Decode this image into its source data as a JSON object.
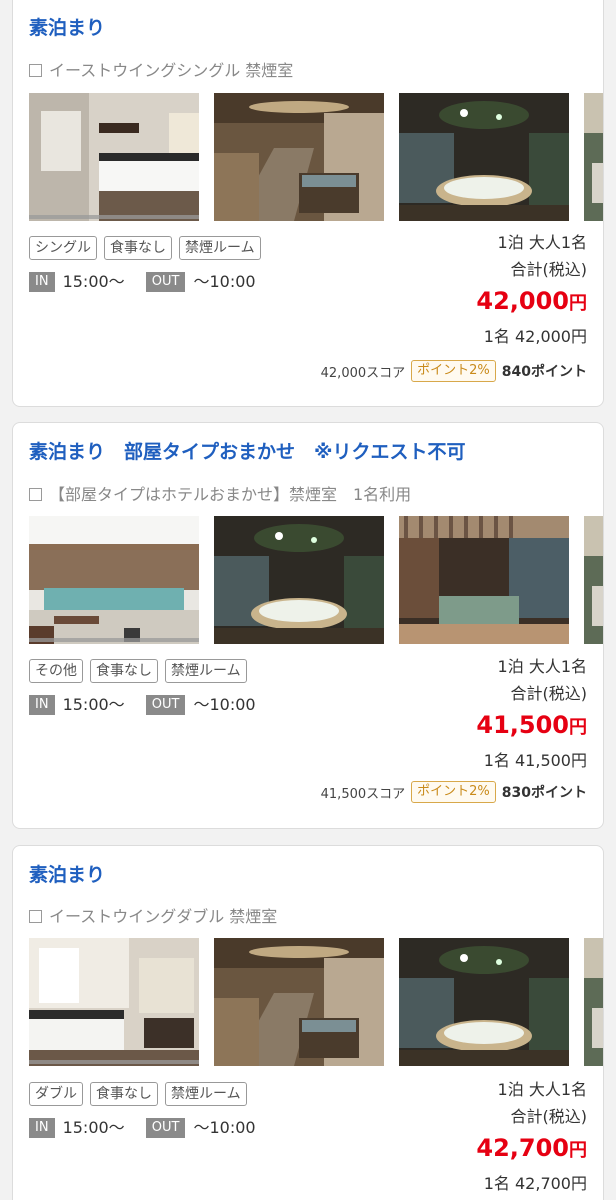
{
  "plans": [
    {
      "title": "素泊まり",
      "room": "イーストウイングシングル 禁煙室",
      "photos": [
        "single-room-photo",
        "indoor-bath-photo",
        "jacuzzi-photo",
        "garden-photo"
      ],
      "tags": [
        "シングル",
        "食事なし",
        "禁煙ルーム"
      ],
      "checkin_label": "IN",
      "checkin_time": "15:00〜",
      "checkout_label": "OUT",
      "checkout_time": "〜10:00",
      "guests": "1泊 大人1名",
      "tax_label": "合計(税込)",
      "total": "42,000",
      "currency": "円",
      "per_person": "1名 42,000円",
      "score": "42,000スコア",
      "point_rate": "ポイント2%",
      "points": "840ポイント"
    },
    {
      "title": "素泊まり　部屋タイプおまかせ　※リクエスト不可",
      "room": "【部屋タイプはホテルおまかせ】禁煙室　1名利用",
      "photos": [
        "open-air-bath-photo",
        "jacuzzi-photo",
        "terrace-bath-photo",
        "garden-photo"
      ],
      "tags": [
        "その他",
        "食事なし",
        "禁煙ルーム"
      ],
      "checkin_label": "IN",
      "checkin_time": "15:00〜",
      "checkout_label": "OUT",
      "checkout_time": "〜10:00",
      "guests": "1泊 大人1名",
      "tax_label": "合計(税込)",
      "total": "41,500",
      "currency": "円",
      "per_person": "1名 41,500円",
      "score": "41,500スコア",
      "point_rate": "ポイント2%",
      "points": "830ポイント"
    },
    {
      "title": "素泊まり",
      "room": "イーストウイングダブル 禁煙室",
      "photos": [
        "double-room-photo",
        "indoor-bath-photo",
        "jacuzzi-photo",
        "garden-photo"
      ],
      "tags": [
        "ダブル",
        "食事なし",
        "禁煙ルーム"
      ],
      "checkin_label": "IN",
      "checkin_time": "15:00〜",
      "checkout_label": "OUT",
      "checkout_time": "〜10:00",
      "guests": "1泊 大人1名",
      "tax_label": "合計(税込)",
      "total": "42,700",
      "currency": "円",
      "per_person": "1名 42,700円"
    }
  ],
  "colors": {
    "title": "#1f5fbf",
    "price": "#e60012",
    "badge": "#c98a1a"
  }
}
